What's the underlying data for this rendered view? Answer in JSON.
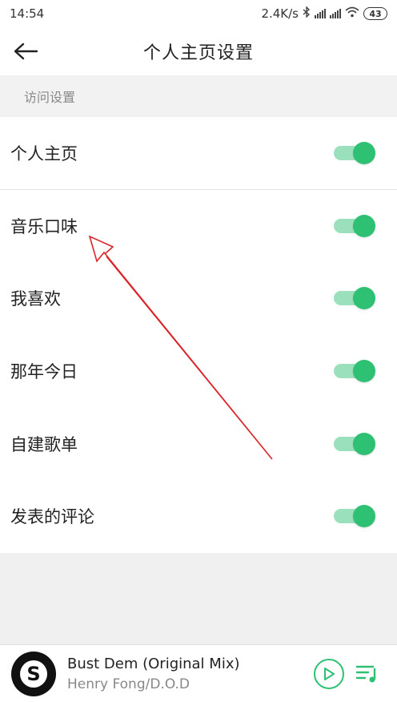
{
  "status_bar": {
    "time": "14:54",
    "network_speed": "2.4K/s",
    "battery": "43"
  },
  "header": {
    "title": "个人主页设置"
  },
  "section": {
    "title": "访问设置"
  },
  "settings": [
    {
      "label": "个人主页",
      "enabled": true
    },
    {
      "label": "音乐口味",
      "enabled": true
    },
    {
      "label": "我喜欢",
      "enabled": true
    },
    {
      "label": "那年今日",
      "enabled": true
    },
    {
      "label": "自建歌单",
      "enabled": true
    },
    {
      "label": "发表的评论",
      "enabled": true
    }
  ],
  "player": {
    "track_title": "Bust Dem (Original Mix)",
    "artist": "Henry Fong/D.O.D"
  },
  "colors": {
    "accent": "#2ec173",
    "track": "#9be0bd",
    "annotation_arrow": "#d9262a"
  },
  "icons": {
    "back": "back-arrow-icon",
    "bluetooth": "bluetooth-icon",
    "signal": "signal-icon",
    "wifi": "wifi-icon",
    "battery": "battery-icon",
    "play": "play-icon",
    "playlist": "playlist-icon"
  }
}
